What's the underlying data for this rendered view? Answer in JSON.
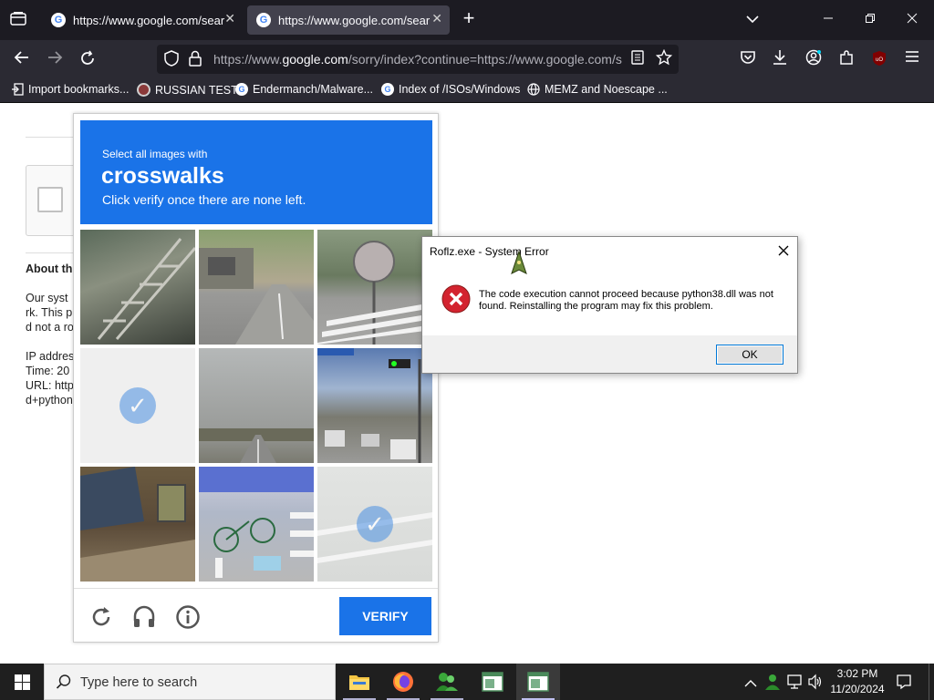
{
  "tabs": [
    {
      "title": "https://www.google.com/search"
    },
    {
      "title": "https://www.google.com/search"
    }
  ],
  "address": {
    "prefix": "https://www.",
    "domain": "google.com",
    "path": "/sorry/index?continue=https://www.google.com/s"
  },
  "bookmarks": [
    {
      "label": "Import bookmarks..."
    },
    {
      "label": "RUSSIAN TEST"
    },
    {
      "label": "Endermanch/Malware..."
    },
    {
      "label": "Index of /ISOs/Windows"
    },
    {
      "label": "MEMZ and Noescape ..."
    }
  ],
  "page": {
    "heading": "About th",
    "lines": [
      "Our syst",
      "rk. This p",
      "d not a ro",
      "IP addres",
      "Time: 20",
      "URL: http",
      "d+python"
    ]
  },
  "captcha": {
    "instruction": "Select all images with",
    "target": "crosswalks",
    "hint": "Click verify once there are none left.",
    "verify_label": "VERIFY",
    "selected_tiles": [
      4,
      9
    ]
  },
  "dialog": {
    "title": "Roflz.exe - System Error",
    "message": "The code execution cannot proceed because python38.dll was not found. Reinstalling the program may fix this problem.",
    "ok_label": "OK"
  },
  "taskbar": {
    "search_placeholder": "Type here to search",
    "time": "3:02 PM",
    "date": "11/20/2024"
  },
  "colors": {
    "captcha_blue": "#1a73e8",
    "tab_bg": "#1c1b22",
    "nav_bg": "#2b2a33",
    "error_red": "#d3232f"
  }
}
